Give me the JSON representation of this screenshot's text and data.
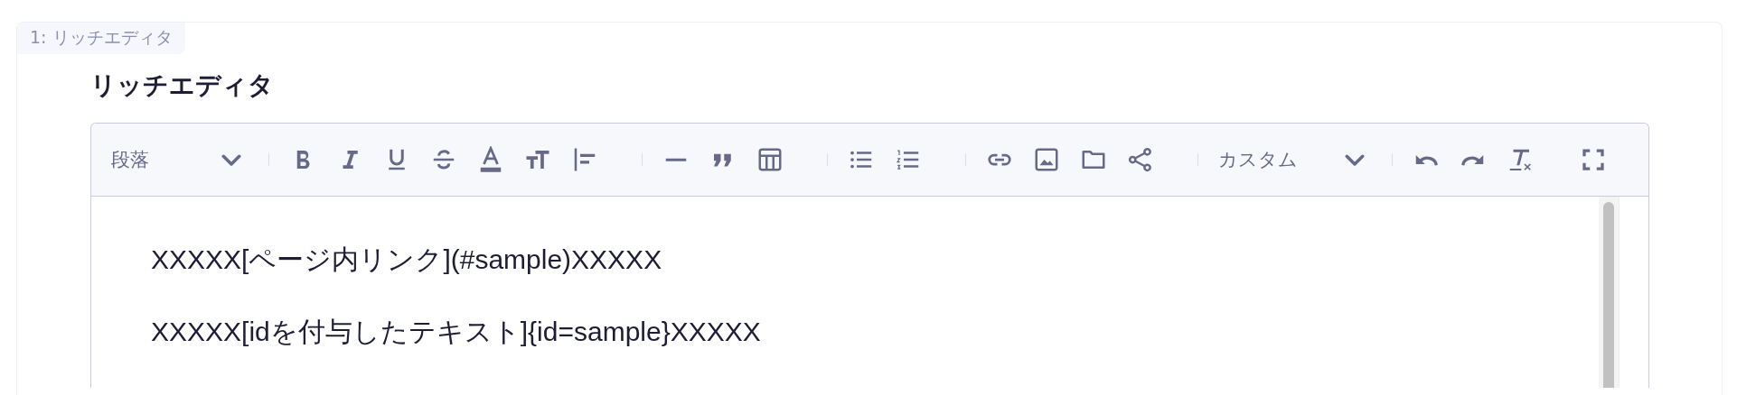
{
  "section": {
    "tab_label": "1: リッチエディタ",
    "heading": "リッチエディタ"
  },
  "editor": {
    "toolbar": {
      "paragraph_select": "段落",
      "custom_select": "カスタム"
    },
    "paragraphs": [
      "XXXXX[ページ内リンク](#sample)XXXXX",
      "XXXXX[idを付与したテキスト]{id=sample}XXXXX"
    ]
  }
}
